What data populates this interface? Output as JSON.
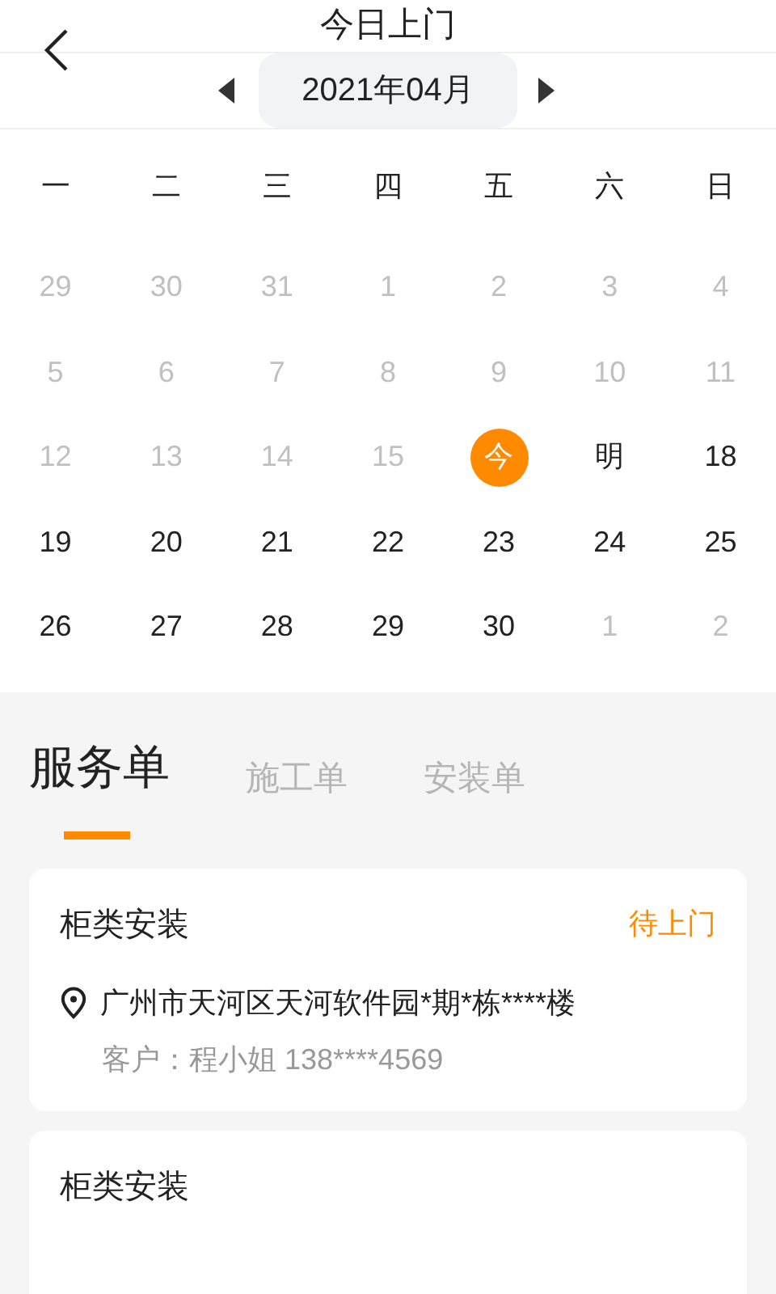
{
  "header": {
    "title": "今日上门"
  },
  "month_picker": {
    "label": "2021年04月"
  },
  "weekdays": [
    "一",
    "二",
    "三",
    "四",
    "五",
    "六",
    "日"
  ],
  "days": [
    {
      "label": "29",
      "muted": true,
      "today": false
    },
    {
      "label": "30",
      "muted": true,
      "today": false
    },
    {
      "label": "31",
      "muted": true,
      "today": false
    },
    {
      "label": "1",
      "muted": true,
      "today": false
    },
    {
      "label": "2",
      "muted": true,
      "today": false
    },
    {
      "label": "3",
      "muted": true,
      "today": false
    },
    {
      "label": "4",
      "muted": true,
      "today": false
    },
    {
      "label": "5",
      "muted": true,
      "today": false
    },
    {
      "label": "6",
      "muted": true,
      "today": false
    },
    {
      "label": "7",
      "muted": true,
      "today": false
    },
    {
      "label": "8",
      "muted": true,
      "today": false
    },
    {
      "label": "9",
      "muted": true,
      "today": false
    },
    {
      "label": "10",
      "muted": true,
      "today": false
    },
    {
      "label": "11",
      "muted": true,
      "today": false
    },
    {
      "label": "12",
      "muted": true,
      "today": false
    },
    {
      "label": "13",
      "muted": true,
      "today": false
    },
    {
      "label": "14",
      "muted": true,
      "today": false
    },
    {
      "label": "15",
      "muted": true,
      "today": false
    },
    {
      "label": "今",
      "muted": false,
      "today": true
    },
    {
      "label": "明",
      "muted": false,
      "today": false
    },
    {
      "label": "18",
      "muted": false,
      "today": false
    },
    {
      "label": "19",
      "muted": false,
      "today": false
    },
    {
      "label": "20",
      "muted": false,
      "today": false
    },
    {
      "label": "21",
      "muted": false,
      "today": false
    },
    {
      "label": "22",
      "muted": false,
      "today": false
    },
    {
      "label": "23",
      "muted": false,
      "today": false
    },
    {
      "label": "24",
      "muted": false,
      "today": false
    },
    {
      "label": "25",
      "muted": false,
      "today": false
    },
    {
      "label": "26",
      "muted": false,
      "today": false
    },
    {
      "label": "27",
      "muted": false,
      "today": false
    },
    {
      "label": "28",
      "muted": false,
      "today": false
    },
    {
      "label": "29",
      "muted": false,
      "today": false
    },
    {
      "label": "30",
      "muted": false,
      "today": false
    },
    {
      "label": "1",
      "muted": true,
      "today": false
    },
    {
      "label": "2",
      "muted": true,
      "today": false
    }
  ],
  "tabs": [
    {
      "label": "服务单",
      "selected": true
    },
    {
      "label": "施工单",
      "selected": false
    },
    {
      "label": "安装单",
      "selected": false
    }
  ],
  "orders": [
    {
      "title": "柜类安装",
      "status": "待上门",
      "address": "广州市天河区天河软件园*期*栋****楼",
      "customer": "客户：程小姐 138****4569"
    },
    {
      "title": "柜类安装"
    }
  ]
}
